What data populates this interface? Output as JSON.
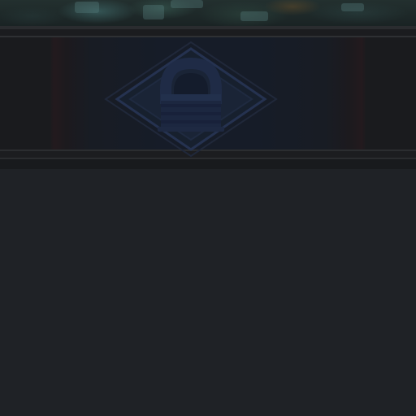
{
  "scene": {
    "background_color": "#1f2226",
    "banner_color": "#161719",
    "emblem_color": "#1c2740",
    "emblem_outline_color": "#253250"
  },
  "emblem": {
    "icon": "locked-padlock-icon",
    "state": "locked"
  }
}
